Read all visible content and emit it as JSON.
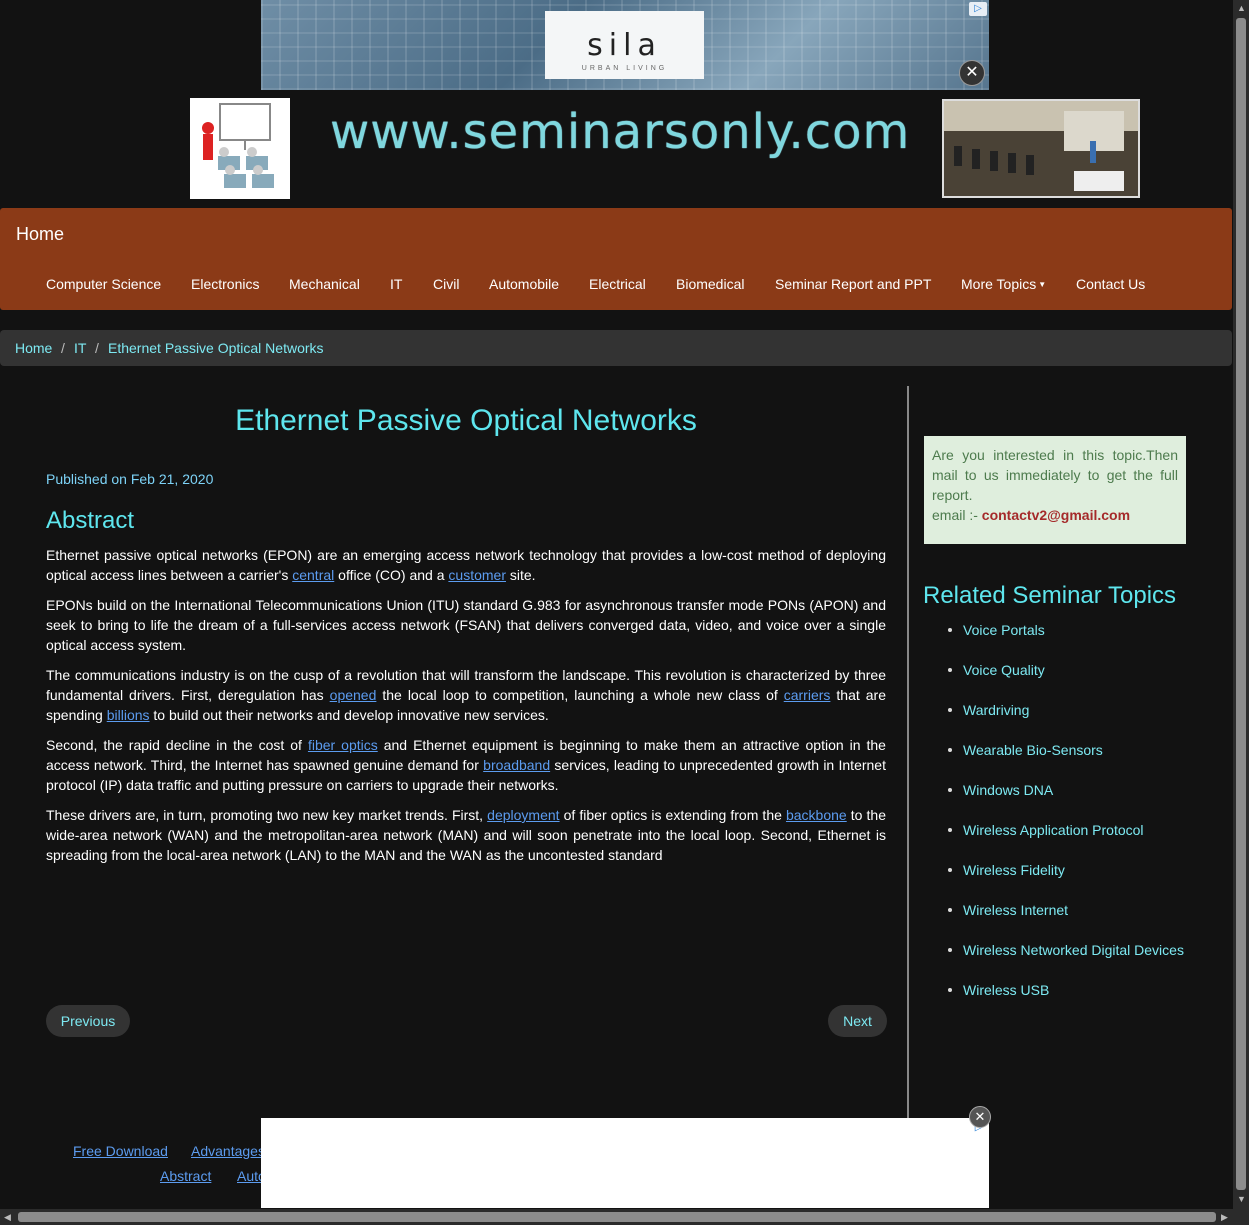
{
  "top_ad": {
    "logo": "sila",
    "tagline": "URBAN LIVING",
    "adchoices_icon": "adchoices-icon",
    "close_icon": "close-icon"
  },
  "header": {
    "site_logo_text": "www.seminarsonly.com"
  },
  "nav": {
    "brand": "Home",
    "items": [
      "Computer Science",
      "Electronics",
      "Mechanical",
      "IT",
      "Civil",
      "Automobile",
      "Electrical",
      "Biomedical",
      "Seminar Report and PPT",
      "More Topics",
      "Contact Us"
    ]
  },
  "breadcrumb": {
    "home": "Home",
    "sep": "/",
    "section": "IT",
    "current": "Ethernet Passive Optical Networks"
  },
  "article": {
    "title": "Ethernet Passive Optical Networks",
    "published": "Published on Feb 21, 2020",
    "abstract_heading": "Abstract",
    "p1": [
      "Ethernet passive optical networks (EPON) are an emerging access network technology that provides a low-cost method of deploying optical access lines between a carrier's ",
      "central",
      " office (CO) and a ",
      "customer",
      " site."
    ],
    "p2": "EPONs build on the International Telecommunications Union (ITU) standard G.983 for asynchronous transfer mode PONs (APON) and seek to bring to life the dream of a full-services access network (FSAN) that delivers converged data, video, and voice over a single optical access system.",
    "p3": [
      "The communications industry is on the cusp of a revolution that will transform the landscape. This revolution is characterized by three fundamental drivers. First, deregulation has ",
      "opened",
      " the local loop to competition, launching a whole new class of ",
      "carriers",
      " that are spending ",
      "billions",
      " to build out their networks and develop innovative new services."
    ],
    "p4": [
      "Second, the rapid decline in the cost of ",
      "fiber optics",
      " and Ethernet equipment is beginning to make them an attractive option in the access network. Third, the Internet has spawned genuine demand for ",
      "broadband",
      " services, leading to unprecedented growth in Internet protocol (IP) data traffic and putting pressure on carriers to upgrade their networks."
    ],
    "p5": [
      "These drivers are, in turn, promoting two new key market trends. First, ",
      "deployment",
      " of fiber optics is extending from the ",
      "backbone",
      " to the wide-area network (WAN) and the metropolitan-area network (MAN) and will soon penetrate into the local loop. Second, Ethernet is spreading from the local-area network (LAN) to the MAN and the WAN as the uncontested standard"
    ],
    "previous": "Previous",
    "next": "Next"
  },
  "sidebar": {
    "contact_text": "Are you interested in this topic.Then mail to us immediately to get the full report.",
    "email_label": "email :- ",
    "email": "contactv2@gmail.com",
    "related_heading": "Related Seminar Topics",
    "related": [
      "Voice Portals",
      "Voice Quality",
      "Wardriving",
      "Wearable Bio-Sensors",
      "Windows DNA",
      "Wireless Application Protocol",
      "Wireless Fidelity",
      "Wireless Internet",
      "Wireless Networked Digital Devices",
      "Wireless USB"
    ]
  },
  "footer": {
    "links": [
      "Free Download",
      "Advantages",
      "Abstract",
      "Auto"
    ]
  },
  "colors": {
    "nav_bg": "#8b3a17",
    "accent": "#5ee6ee",
    "link": "#5c9cf0",
    "page_bg": "#121212"
  }
}
